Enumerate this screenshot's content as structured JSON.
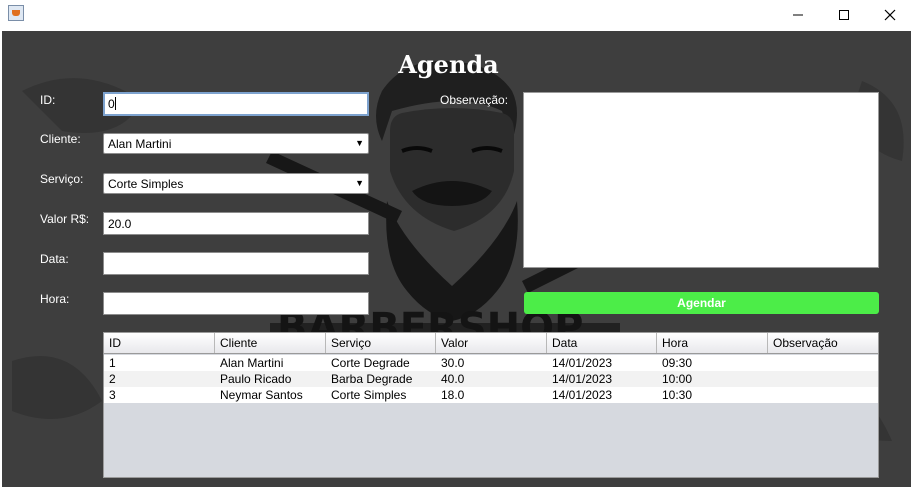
{
  "window": {
    "minimize_glyph": "minimize-icon",
    "maximize_glyph": "maximize-icon",
    "close_glyph": "close-icon",
    "app_icon": "java-cup-icon"
  },
  "page": {
    "title": "Agenda",
    "background_watermark": "BARBERSHOP"
  },
  "form": {
    "id_label": "ID:",
    "id_value": "0",
    "cliente_label": "Cliente:",
    "cliente_value": "Alan Martini",
    "servico_label": "Serviço:",
    "servico_value": "Corte Simples",
    "valor_label": "Valor R$:",
    "valor_value": "20.0",
    "data_label": "Data:",
    "data_value": "",
    "hora_label": "Hora:",
    "hora_value": "",
    "observacao_label": "Observação:",
    "observacao_value": "",
    "agendar_label": "Agendar"
  },
  "colors": {
    "panel_bg": "#3e3e3e",
    "button_green": "#4ced48",
    "table_empty_bg": "#d6d9df",
    "focus_border": "#7da2ce"
  },
  "table": {
    "columns": [
      "ID",
      "Cliente",
      "Serviço",
      "Valor",
      "Data",
      "Hora",
      "Observação"
    ],
    "rows": [
      [
        "1",
        "Alan Martini",
        "Corte Degrade",
        "30.0",
        "14/01/2023",
        "09:30",
        ""
      ],
      [
        "2",
        "Paulo Ricado",
        "Barba Degrade",
        "40.0",
        "14/01/2023",
        "10:00",
        ""
      ],
      [
        "3",
        "Neymar Santos",
        "Corte Simples",
        "18.0",
        "14/01/2023",
        "10:30",
        ""
      ]
    ]
  }
}
